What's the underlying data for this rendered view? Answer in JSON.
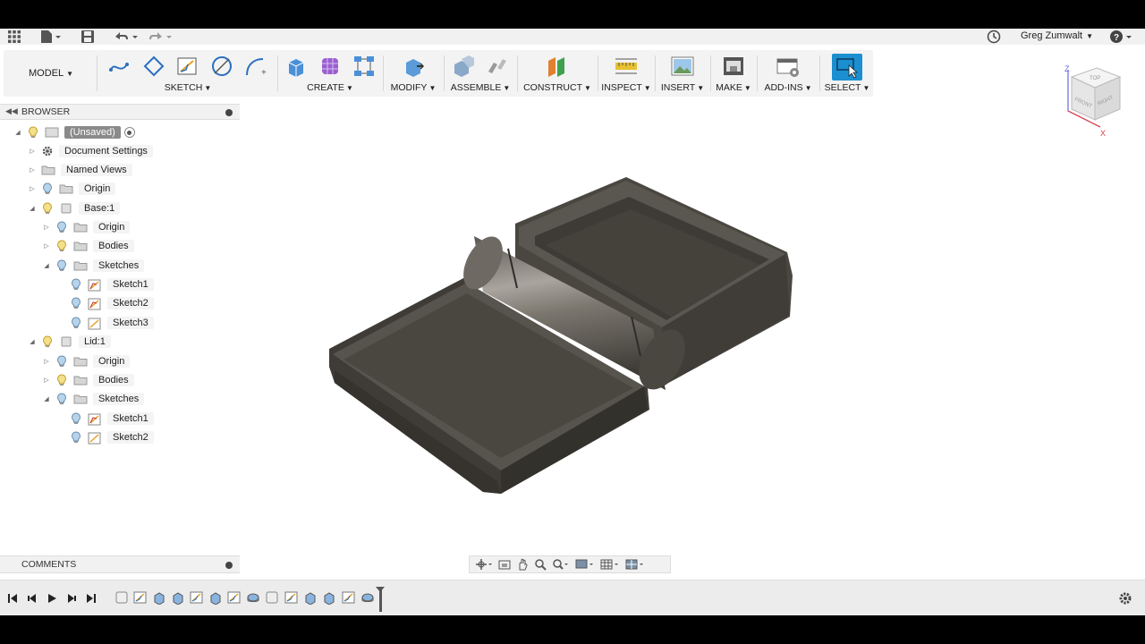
{
  "topbar": {
    "apps_icon": "grid-icon",
    "file_icon": "file-icon",
    "save_icon": "save-icon",
    "undo_icon": "undo-icon",
    "redo_icon": "redo-icon",
    "history_icon": "clock-icon",
    "user_name": "Greg Zumwalt",
    "help_icon": "help-icon"
  },
  "ribbon": {
    "workspace": "MODEL",
    "groups": {
      "sketch": "SKETCH",
      "create": "CREATE",
      "modify": "MODIFY",
      "assemble": "ASSEMBLE",
      "construct": "CONSTRUCT",
      "inspect": "INSPECT",
      "insert": "INSERT",
      "make": "MAKE",
      "addins": "ADD-INS",
      "select": "SELECT"
    },
    "accent_color": "#1b8fd0"
  },
  "browser": {
    "title": "BROWSER",
    "root": "(Unsaved)",
    "nodes": {
      "document_settings": "Document Settings",
      "named_views": "Named Views",
      "origin": "Origin",
      "base": "Base:1",
      "base_origin": "Origin",
      "base_bodies": "Bodies",
      "base_sketches": "Sketches",
      "base_sketch1": "Sketch1",
      "base_sketch2": "Sketch2",
      "base_sketch3": "Sketch3",
      "lid": "Lid:1",
      "lid_origin": "Origin",
      "lid_bodies": "Bodies",
      "lid_sketches": "Sketches",
      "lid_sketch1": "Sketch1",
      "lid_sketch2": "Sketch2"
    }
  },
  "comments": {
    "title": "COMMENTS"
  },
  "viewcube": {
    "top": "TOP",
    "front": "FRONT",
    "right": "RIGHT",
    "axis_z": "Z",
    "axis_x": "X"
  },
  "timeline": {
    "settings_icon": "gear-icon"
  }
}
